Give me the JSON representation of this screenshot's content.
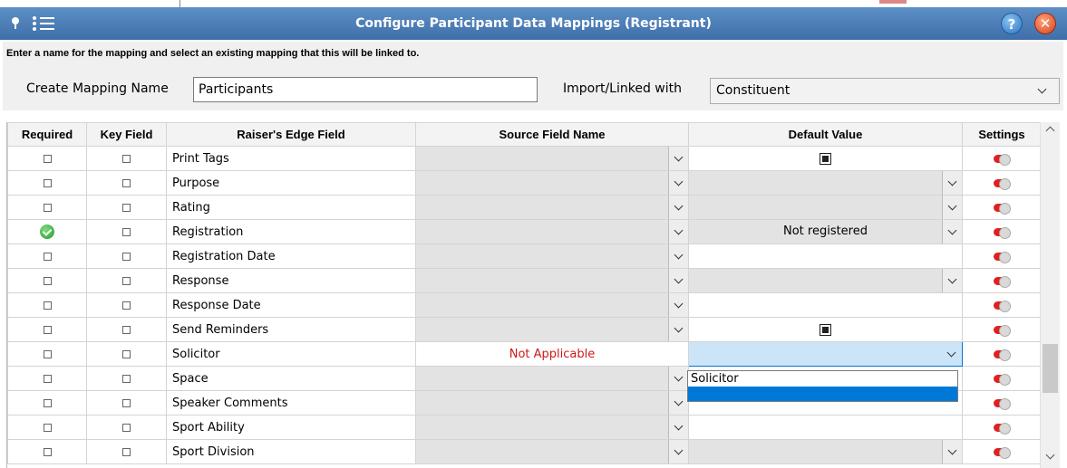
{
  "window": {
    "title": "Configure Participant Data Mappings (Registrant)"
  },
  "header": {
    "instruction": "Enter a name for the mapping and select an existing mapping that this will be linked to.",
    "mapping_name_label": "Create Mapping Name",
    "mapping_name_value": "Participants",
    "import_label": "Import/Linked with",
    "import_value": "Constituent"
  },
  "grid": {
    "columns": [
      "Required",
      "Key Field",
      "Raiser's Edge Field",
      "Source Field Name",
      "Default Value",
      "Settings"
    ],
    "rows": [
      {
        "field": "Print Tags",
        "default": ""
      },
      {
        "field": "Purpose",
        "default": ""
      },
      {
        "field": "Rating",
        "default": ""
      },
      {
        "field": "Registration",
        "default": "Not registered"
      },
      {
        "field": "Registration Date",
        "default": ""
      },
      {
        "field": "Response",
        "default": ""
      },
      {
        "field": "Response Date",
        "default": ""
      },
      {
        "field": "Send Reminders",
        "default": ""
      },
      {
        "field": "Solicitor",
        "source": "Not Applicable",
        "default": ""
      },
      {
        "field": "Space",
        "default": ""
      },
      {
        "field": "Speaker Comments",
        "default": ""
      },
      {
        "field": "Sport Ability",
        "default": ""
      },
      {
        "field": "Sport Division",
        "default": ""
      }
    ]
  },
  "dropdown_popup": {
    "options": [
      "Solicitor",
      ""
    ]
  },
  "icons": {
    "help": "?",
    "close": "✕"
  },
  "colors": {
    "title_bar": "#4a7cb8",
    "not_applicable": "#d01818",
    "selection": "#0078d7",
    "required_ok": "#1e9a2c",
    "toggle_off": "#e02020"
  }
}
